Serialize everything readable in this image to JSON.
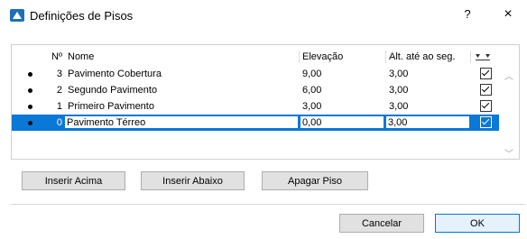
{
  "window": {
    "title": "Definições de Pisos",
    "help": "?",
    "close": "×"
  },
  "table": {
    "headers": {
      "num": "Nº",
      "name": "Nome",
      "elevation": "Elevação",
      "alt": "Alt. até ao seg.",
      "visibility_icon": "visibility-filter-icon"
    },
    "rows": [
      {
        "num": "3",
        "name": "Pavimento Cobertura",
        "elevation": "9,00",
        "alt": "3,00",
        "checked": true,
        "selected": false
      },
      {
        "num": "2",
        "name": "Segundo Pavimento",
        "elevation": "6,00",
        "alt": "3,00",
        "checked": true,
        "selected": false
      },
      {
        "num": "1",
        "name": "Primeiro Pavimento",
        "elevation": "3,00",
        "alt": "3,00",
        "checked": true,
        "selected": false
      },
      {
        "num": "0",
        "name": "Pavimento Térreo",
        "elevation": "0,00",
        "alt": "3,00",
        "checked": true,
        "selected": true
      }
    ]
  },
  "buttons": {
    "insert_above": "Inserir Acima",
    "insert_below": "Inserir Abaixo",
    "delete": "Apagar Piso",
    "cancel": "Cancelar",
    "ok": "OK"
  },
  "colors": {
    "selection": "#0a78d7",
    "ok_border": "#0078d7"
  }
}
